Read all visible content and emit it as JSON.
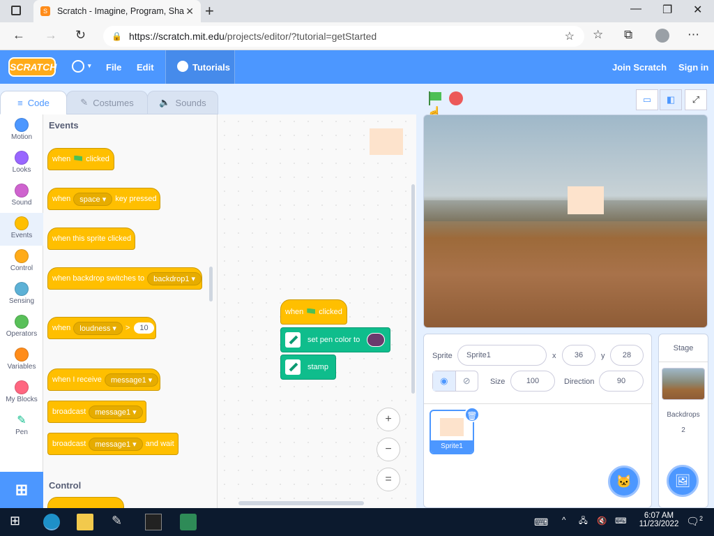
{
  "browser": {
    "tab_title": "Scratch - Imagine, Program, Sha",
    "url_host": "https://scratch.mit.edu",
    "url_path": "/projects/editor/?tutorial=getStarted"
  },
  "menu": {
    "logo": "SCRATCH",
    "file": "File",
    "edit": "Edit",
    "tutorials": "Tutorials",
    "join": "Join Scratch",
    "signin": "Sign in"
  },
  "editor_tabs": {
    "code": "Code",
    "costumes": "Costumes",
    "sounds": "Sounds"
  },
  "categories": [
    {
      "label": "Motion",
      "color": "#4c97ff"
    },
    {
      "label": "Looks",
      "color": "#9966ff"
    },
    {
      "label": "Sound",
      "color": "#cf63cf"
    },
    {
      "label": "Events",
      "color": "#ffbf00"
    },
    {
      "label": "Control",
      "color": "#ffab19"
    },
    {
      "label": "Sensing",
      "color": "#5cb1d6"
    },
    {
      "label": "Operators",
      "color": "#59c059"
    },
    {
      "label": "Variables",
      "color": "#ff8c1a"
    },
    {
      "label": "My Blocks",
      "color": "#ff6680"
    },
    {
      "label": "Pen",
      "color": "#0fbd8c"
    }
  ],
  "palette": {
    "events_title": "Events",
    "control_title": "Control",
    "b1_when": "when",
    "b1_clicked": "clicked",
    "b2_when": "when",
    "b2_key": "space",
    "b2_rest": "key pressed",
    "b3": "when this sprite clicked",
    "b4_text": "when backdrop switches to",
    "b4_drop": "backdrop1",
    "b5_when": "when",
    "b5_drop": "loudness",
    "b5_op": ">",
    "b5_val": "10",
    "b6_text": "when I receive",
    "b6_drop": "message1",
    "b7_text": "broadcast",
    "b7_drop": "message1",
    "b8_text": "broadcast",
    "b8_drop": "message1",
    "b8_rest": "and wait"
  },
  "script": {
    "when": "when",
    "clicked": "clicked",
    "set_pen": "set pen color to",
    "stamp": "stamp",
    "pen_color": "#6b3a6d"
  },
  "sprite_info": {
    "sprite_label": "Sprite",
    "name": "Sprite1",
    "x_label": "x",
    "x": "36",
    "y_label": "y",
    "y": "28",
    "size_label": "Size",
    "size": "100",
    "direction_label": "Direction",
    "direction": "90"
  },
  "sprite_card": {
    "name": "Sprite1"
  },
  "stage_panel": {
    "title": "Stage",
    "backdrops_label": "Backdrops",
    "backdrops_count": "2"
  },
  "taskbar": {
    "time": "6:07 AM",
    "date": "11/23/2022",
    "notif_count": "2"
  }
}
